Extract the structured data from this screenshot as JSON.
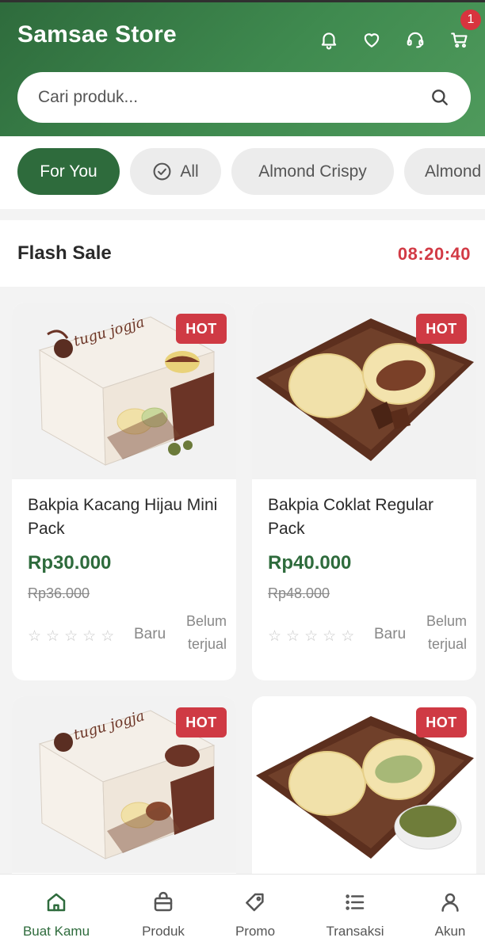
{
  "header": {
    "title": "Samsae Store",
    "icons": [
      "bell-icon",
      "heart-icon",
      "headset-icon",
      "cart-icon"
    ],
    "cart_count": "1",
    "gradient_colors": [
      "#2e6b3c",
      "#4f9a5c"
    ]
  },
  "search": {
    "placeholder": "Cari produk..."
  },
  "chips": [
    {
      "label": "For You",
      "active": true
    },
    {
      "label": "All",
      "icon": "check-circle-icon"
    },
    {
      "label": "Almond Crispy"
    },
    {
      "label": "Almond"
    }
  ],
  "flash_sale": {
    "title": "Flash Sale",
    "timer": "08:20:40"
  },
  "products": [
    {
      "name": "Bakpia Kacang Hijau Mini Pack",
      "badge": "HOT",
      "price": "Rp30.000",
      "old_price": "Rp36.000",
      "status": "Baru",
      "sold": "Belum terjual",
      "rating": 0,
      "image": "box-package"
    },
    {
      "name": "Bakpia Coklat Regular Pack",
      "badge": "HOT",
      "price": "Rp40.000",
      "old_price": "Rp48.000",
      "status": "Baru",
      "sold": "Belum terjual",
      "rating": 0,
      "image": "bakpia-chocolate-plate"
    },
    {
      "badge": "HOT",
      "image": "box-package"
    },
    {
      "badge": "HOT",
      "image": "bakpia-greenbean-plate"
    }
  ],
  "bottom_nav": [
    {
      "label": "Buat Kamu",
      "icon": "home-icon",
      "active": true
    },
    {
      "label": "Produk",
      "icon": "bag-icon"
    },
    {
      "label": "Promo",
      "icon": "tag-icon"
    },
    {
      "label": "Transaksi",
      "icon": "list-icon"
    },
    {
      "label": "Akun",
      "icon": "user-icon"
    }
  ],
  "colors": {
    "primary": "#2e6b3c",
    "accent_red": "#d23a45",
    "badge_red": "#cf3a44"
  }
}
